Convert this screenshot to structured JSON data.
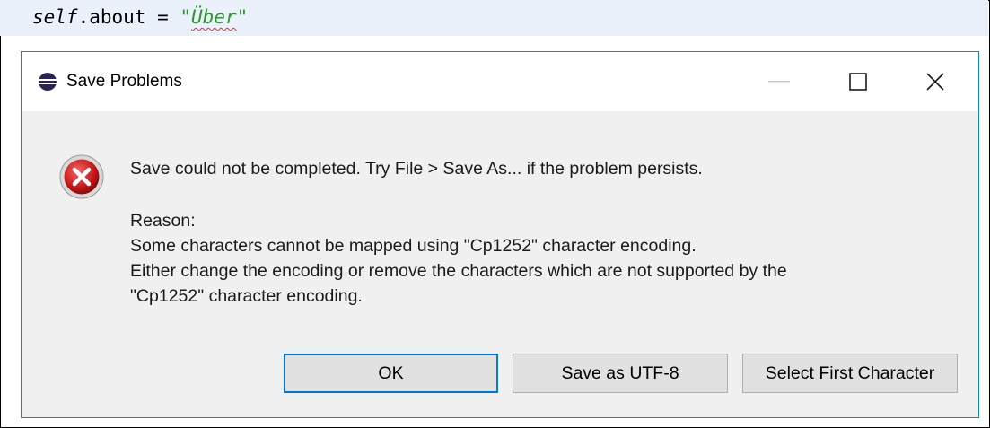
{
  "editor": {
    "code_object": "self",
    "code_rest": ".about = ",
    "code_quote_open": "\"",
    "code_string": "Über",
    "code_quote_close": "\""
  },
  "dialog": {
    "title": "Save Problems",
    "message": "Save could not be completed. Try File > Save As... if the problem persists.",
    "reason_label": "Reason:",
    "reason_lines": [
      "Some characters cannot be mapped using \"Cp1252\" character encoding.",
      "Either change the encoding or remove the characters which are not supported by the",
      "\"Cp1252\" character encoding."
    ],
    "buttons": {
      "ok": "OK",
      "save_utf8": "Save as UTF-8",
      "select_first": "Select First Character"
    }
  },
  "icons": {
    "app": "eclipse-icon",
    "error": "error-icon",
    "minimize": "minimize-icon",
    "maximize": "maximize-icon",
    "close": "close-icon"
  },
  "colors": {
    "accent": "#0078d7",
    "dialog_border": "#1b7fd4",
    "error_red": "#d02020",
    "string_green": "#2a9a2a"
  }
}
